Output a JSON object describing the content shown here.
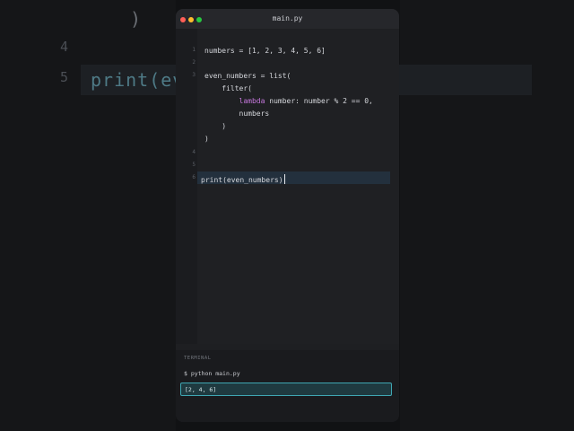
{
  "window": {
    "title": "main.py"
  },
  "background": {
    "line_numbers": [
      "4",
      "5"
    ],
    "code_fragment": "print(eve",
    "paren": ")"
  },
  "editor": {
    "line_numbers": [
      "1",
      "2",
      "3",
      "4",
      "5",
      "6"
    ],
    "lines": [
      "numbers = [1, 2, 3, 4, 5, 6]",
      "",
      "even_numbers = list(",
      "    filter(",
      "        lambda number: number % 2 == 0,",
      "        numbers",
      "    )",
      ")",
      "",
      "print(even_numbers)"
    ],
    "keyword": "lambda",
    "lambda_rest": " number: number % 2 == 0,",
    "current_line": "print(even_numbers)"
  },
  "terminal": {
    "title": "TERMINAL",
    "command": "$ python main.py",
    "output": "[2, 4, 6]"
  },
  "colors": {
    "keyword": "#c678dd",
    "terminal_border": "#3fa7b3",
    "active_line": "#23303d"
  }
}
